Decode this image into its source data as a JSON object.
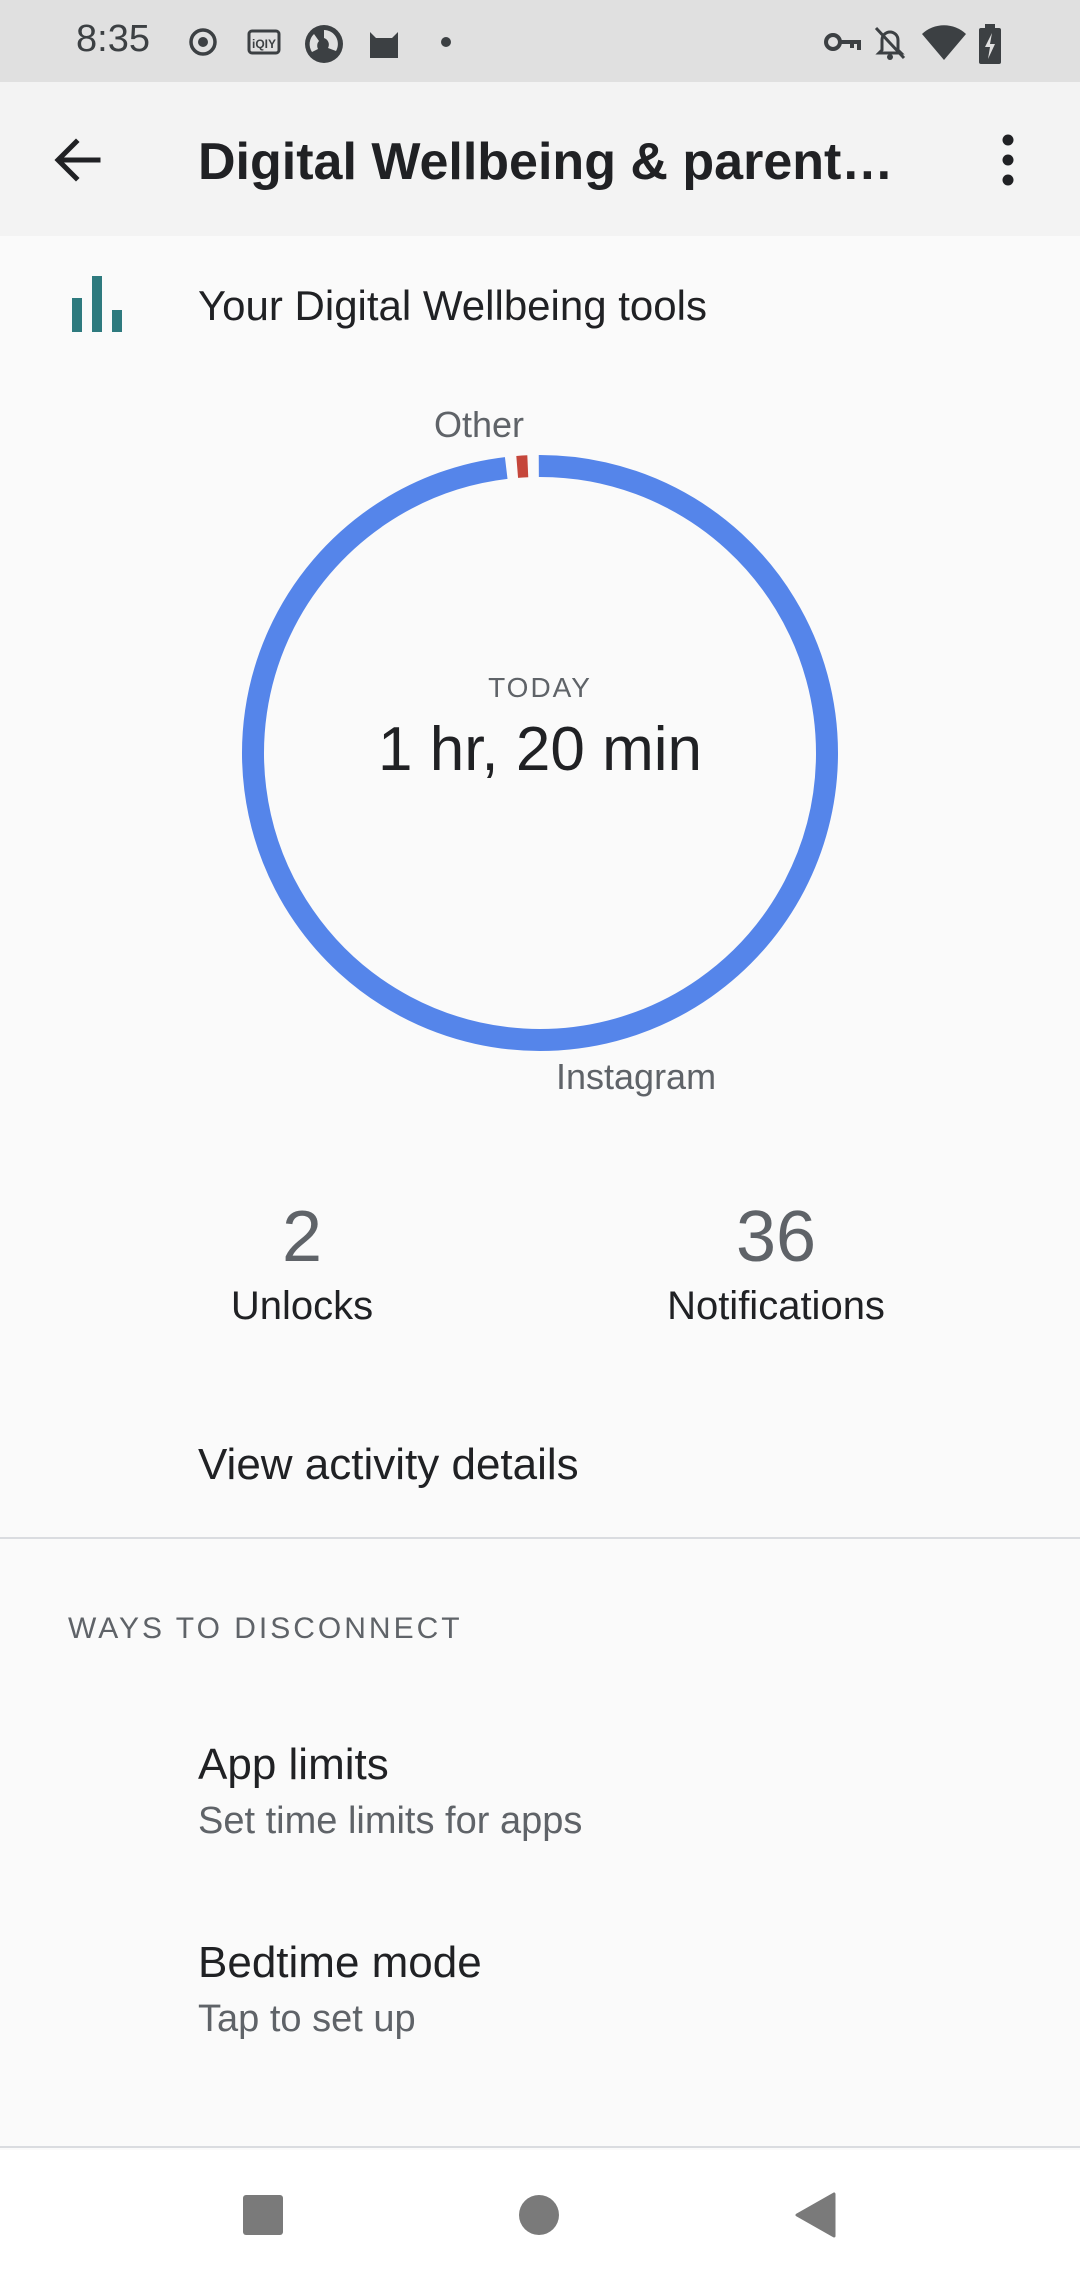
{
  "status_bar": {
    "time": "8:35",
    "left_icons": [
      "record-icon",
      "iqiyi-icon",
      "browser-icon",
      "cat-app-icon",
      "dot-icon"
    ],
    "right_icons": [
      "vpn-key-icon",
      "notifications-off-icon",
      "wifi-icon",
      "battery-charging-icon"
    ]
  },
  "app_bar": {
    "title": "Digital Wellbeing & parental controls"
  },
  "tools": {
    "label": "Your Digital Wellbeing tools"
  },
  "usage": {
    "period_label": "TODAY",
    "total": "1 hr, 20 min"
  },
  "chart_data": {
    "type": "pie",
    "labels": [
      "Instagram",
      "Other"
    ],
    "values": [
      98.8,
      1.2
    ],
    "colors": [
      "#5585ea",
      "#c5463b"
    ]
  },
  "stats": {
    "unlocks": {
      "value": "2",
      "label": "Unlocks"
    },
    "notifications": {
      "value": "36",
      "label": "Notifications"
    }
  },
  "activity": {
    "link": "View activity details"
  },
  "disconnect": {
    "header": "WAYS TO DISCONNECT",
    "items": [
      {
        "title": "App limits",
        "subtitle": "Set time limits for apps"
      },
      {
        "title": "Bedtime mode",
        "subtitle": "Tap to set up"
      }
    ]
  }
}
